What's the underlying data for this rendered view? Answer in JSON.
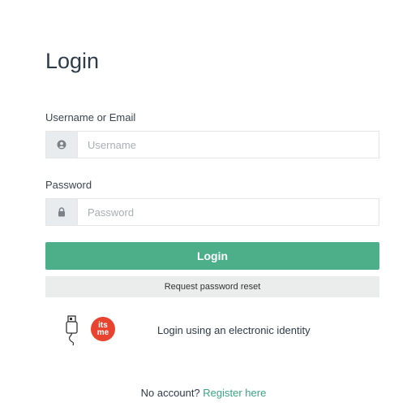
{
  "page": {
    "title": "Login"
  },
  "username": {
    "label": "Username or Email",
    "placeholder": "Username",
    "icon": "user-icon"
  },
  "password": {
    "label": "Password",
    "placeholder": "Password",
    "icon": "lock-icon"
  },
  "buttons": {
    "login": "Login",
    "reset": "Request password reset"
  },
  "eid": {
    "logo_line1": "its",
    "logo_line2": "me",
    "text": "Login using an electronic identity",
    "reader_icon": "card-reader-icon",
    "logo_icon": "itsme-logo"
  },
  "footer": {
    "prompt": "No account? ",
    "link": "Register here"
  },
  "colors": {
    "accent": "#4caf8a",
    "link": "#3aa57f",
    "itsme": "#e8432f"
  }
}
